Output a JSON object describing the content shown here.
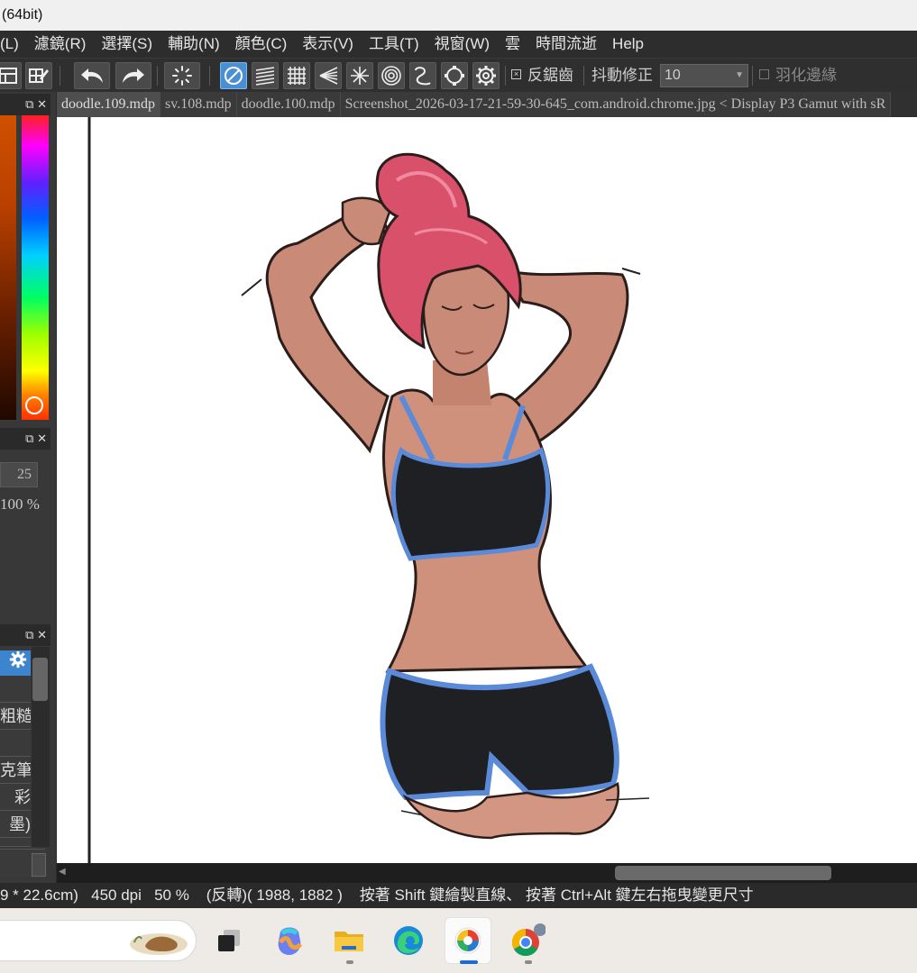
{
  "window": {
    "title": "(64bit)"
  },
  "menu": {
    "items": [
      "(L)",
      "濾鏡(R)",
      "選擇(S)",
      "輔助(N)",
      "顏色(C)",
      "表示(V)",
      "工具(T)",
      "視窗(W)",
      "雲",
      "時間流逝",
      "Help"
    ]
  },
  "toolbar": {
    "antialias_label": "反鋸齒",
    "antialias_checked": true,
    "stabilizer_label": "抖動修正",
    "stabilizer_value": "10",
    "feather_label": "羽化邊緣",
    "feather_checked": false,
    "icons": [
      "layer-grid-icon",
      "layer-edit-icon",
      "undo-icon",
      "redo-icon",
      "deselect-icon",
      "snap-off-icon",
      "snap-parallel-icon",
      "snap-grid-icon",
      "snap-vanishing-icon",
      "snap-radial-icon",
      "snap-concentric-icon",
      "snap-curve-icon",
      "snap-ellipse-icon",
      "snap-settings-icon"
    ]
  },
  "color_panel": {
    "hue_knob_color": "#ff3000"
  },
  "brush_panel": {
    "size_value": "25",
    "opacity_label": "100 %"
  },
  "brush_list": {
    "items": [
      "",
      "粗糙",
      "",
      "克筆",
      "彩",
      "墨)",
      ""
    ]
  },
  "tabs": [
    {
      "label": "doodle.109.mdp",
      "active": true
    },
    {
      "label": "sv.108.mdp",
      "active": false
    },
    {
      "label": "doodle.100.mdp",
      "active": false
    },
    {
      "label": "Screenshot_2026-03-17-21-59-30-645_com.android.chrome.jpg < Display P3 Gamut with sR",
      "active": false
    }
  ],
  "status": {
    "size": "9 * 22.6cm)",
    "dpi": "450 dpi",
    "zoom": "50 %",
    "cursor": "(反轉)( 1988, 1882 )",
    "hint": "按著 Shift 鍵繪製直線、 按著 Ctrl+Alt 鍵左右拖曳變更尺寸"
  },
  "taskbar": {
    "apps": [
      "search-box",
      "task-view-icon",
      "copilot-icon",
      "file-explorer-icon",
      "edge-icon",
      "medibang-icon",
      "chrome-icon"
    ],
    "active_app": "medibang-icon"
  },
  "colors": {
    "accent": "#4a8fd4",
    "hair": "#d8506a",
    "skin": "#c98a78",
    "top": "#1f2024",
    "trim": "#5a8ad8"
  }
}
